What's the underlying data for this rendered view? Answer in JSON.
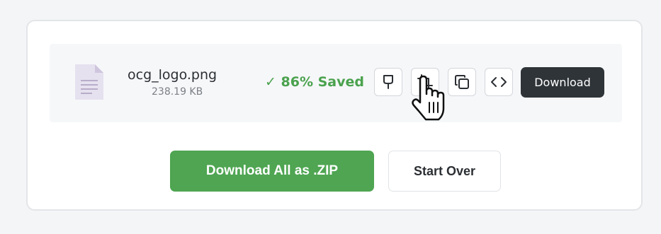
{
  "file": {
    "name": "ocg_logo.png",
    "size": "238.19 KB",
    "saved_label": "✓ 86% Saved",
    "file_icon": "document-icon"
  },
  "toolbar": {
    "icons": [
      "stamp-icon",
      "crop-icon",
      "copy-icon",
      "code-icon"
    ],
    "download_label": "Download"
  },
  "actions": {
    "zip_label": "Download All as .ZIP",
    "start_over_label": "Start Over"
  },
  "cursor": "hand-pointer-cursor",
  "colors": {
    "accent_green": "#4fa552",
    "saved_green": "#4aa24e",
    "dark_button": "#2f3438",
    "row_background": "#f6f7f9"
  }
}
